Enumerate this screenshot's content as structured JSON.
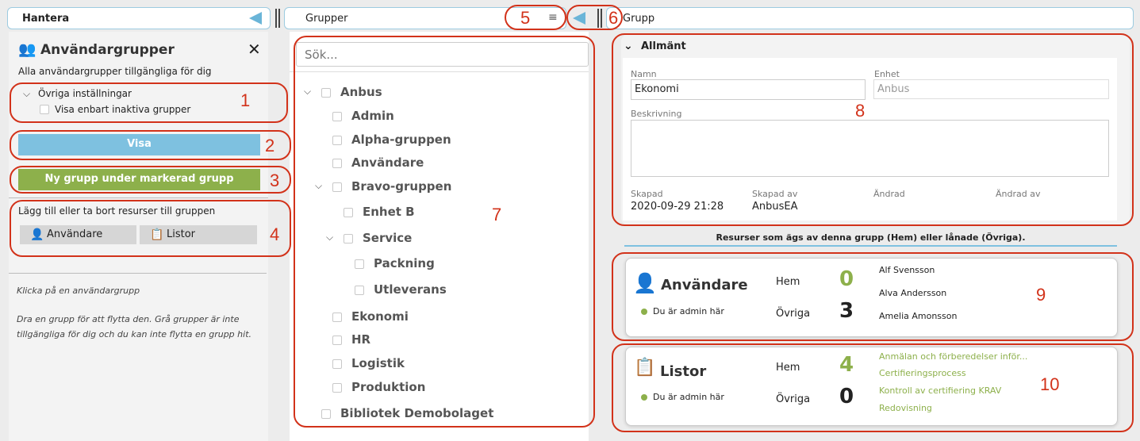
{
  "left": {
    "header": "Hantera",
    "title": "Användargrupper",
    "subtitle": "Alla användargrupper tillgängliga för dig",
    "settings_label": "Övriga inställningar",
    "checkbox_label": "Visa enbart inaktiva grupper",
    "show_button": "Visa",
    "new_group_button": "Ny grupp under markerad grupp",
    "resources_label": "Lägg till eller ta bort resurser till gruppen",
    "users_button": "Användare",
    "lists_button": "Listor",
    "hint1": "Klicka på en användargrupp",
    "hint2": "Dra en grupp för att flytta den. Grå grupper är inte tillgängliga för dig och du kan inte flytta en grupp hit."
  },
  "middle": {
    "header": "Grupper",
    "search_placeholder": "Sök...",
    "tree": [
      {
        "label": "Anbus",
        "depth": 0,
        "expanded": true
      },
      {
        "label": "Admin",
        "depth": 1
      },
      {
        "label": "Alpha-gruppen",
        "depth": 1
      },
      {
        "label": "Användare",
        "depth": 1
      },
      {
        "label": "Bravo-gruppen",
        "depth": 1,
        "expanded": true
      },
      {
        "label": "Enhet B",
        "depth": 2
      },
      {
        "label": "Service",
        "depth": 2,
        "expanded": true
      },
      {
        "label": "Packning",
        "depth": 3
      },
      {
        "label": "Utleverans",
        "depth": 3
      },
      {
        "label": "Ekonomi",
        "depth": 1
      },
      {
        "label": "HR",
        "depth": 1
      },
      {
        "label": "Logistik",
        "depth": 1
      },
      {
        "label": "Produktion",
        "depth": 1
      },
      {
        "label": "Bibliotek Demobolaget",
        "depth": 0
      }
    ]
  },
  "right": {
    "header": "Grupp",
    "section_title": "Allmänt",
    "name_label": "Namn",
    "name_value": "Ekonomi",
    "unit_label": "Enhet",
    "unit_value": "Anbus",
    "description_label": "Beskrivning",
    "created_label": "Skapad",
    "created_value": "2020-09-29 21:28",
    "created_by_label": "Skapad av",
    "created_by_value": "AnbusEA",
    "changed_label": "Ändrad",
    "changed_by_label": "Ändrad av",
    "resources_caption": "Resurser som ägs av denna grupp (Hem) eller lånade (Övriga).",
    "users_card": {
      "title": "Användare",
      "admin_note": "Du är admin här",
      "home_label": "Hem",
      "home_count": "0",
      "other_label": "Övriga",
      "other_count": "3",
      "items": [
        "Alf Svensson",
        "Alva Andersson",
        "Amelia Amonsson"
      ]
    },
    "lists_card": {
      "title": "Listor",
      "admin_note": "Du är admin här",
      "home_label": "Hem",
      "home_count": "4",
      "other_label": "Övriga",
      "other_count": "0",
      "items": [
        "Anmälan och förberedelser inför...",
        "Certifieringsprocess",
        "Kontroll av certifiering KRAV",
        "Redovisning"
      ]
    }
  },
  "annotations": [
    "1",
    "2",
    "3",
    "4",
    "5",
    "6",
    "7",
    "8",
    "9",
    "10"
  ],
  "colors": {
    "accent_blue": "#7ec1e0",
    "accent_green": "#8db04b",
    "annotation_red": "#d2321a"
  }
}
